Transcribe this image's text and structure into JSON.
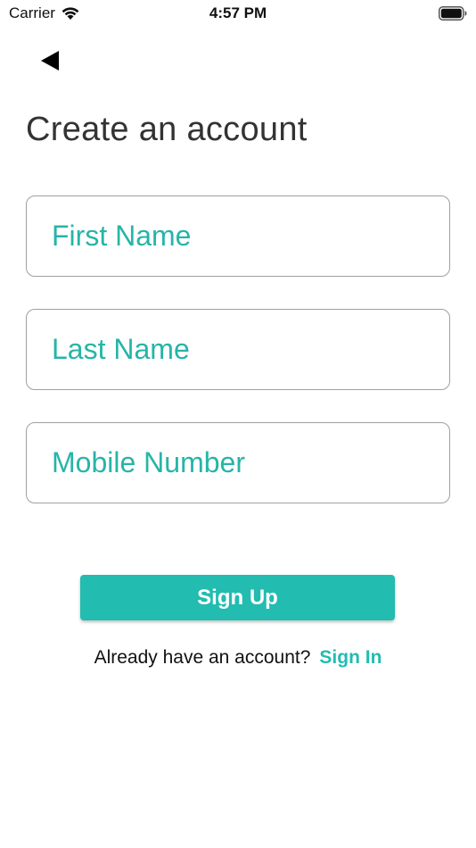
{
  "status_bar": {
    "carrier": "Carrier",
    "time": "4:57 PM",
    "wifi_icon": "wifi-icon",
    "battery_icon": "battery-full-icon"
  },
  "header": {
    "back_icon": "back-arrow-icon",
    "title": "Create an account"
  },
  "form": {
    "first_name": {
      "value": "",
      "placeholder": "First Name"
    },
    "last_name": {
      "value": "",
      "placeholder": "Last Name"
    },
    "mobile_number": {
      "value": "",
      "placeholder": "Mobile Number"
    },
    "signup_label": "Sign Up"
  },
  "footer": {
    "prompt": "Already have an account?",
    "signin_label": "Sign In"
  },
  "colors": {
    "accent": "#22bcb0",
    "placeholder": "#26b5a8",
    "border": "#a0a0a0",
    "title": "#333333"
  }
}
